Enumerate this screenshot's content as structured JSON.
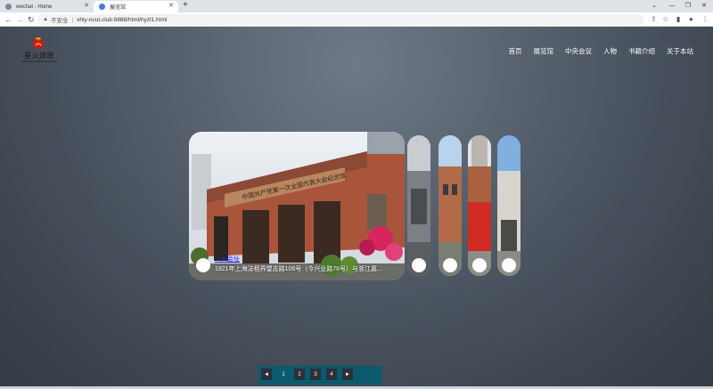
{
  "browser": {
    "tabs": [
      {
        "title": "wechat - Home",
        "active": false
      },
      {
        "title": "展览馆",
        "active": true
      }
    ],
    "new_tab_label": "+",
    "address": {
      "security_label": "不安全",
      "url": "xhly-ncut.club:8888/html/hyzl1.html"
    }
  },
  "site": {
    "logo_text": "星火燎原",
    "nav": [
      "首页",
      "展览馆",
      "中央会议",
      "人物",
      "书籍介绍",
      "关于本站"
    ]
  },
  "carousel": {
    "main": {
      "title": "一大会址",
      "caption": "1921年上海法租界望志路106号（今兴业路76号）与浙江嘉..."
    }
  },
  "pagination": {
    "prev": "◄",
    "pages": [
      "1",
      "2",
      "3",
      "4"
    ],
    "current": "1",
    "next": "►"
  },
  "colors": {
    "page_bg": "#4b5663",
    "pager_bg": "#0c5a6e",
    "nav_text": "#ffffff",
    "caption_link": "#1d1dff"
  }
}
